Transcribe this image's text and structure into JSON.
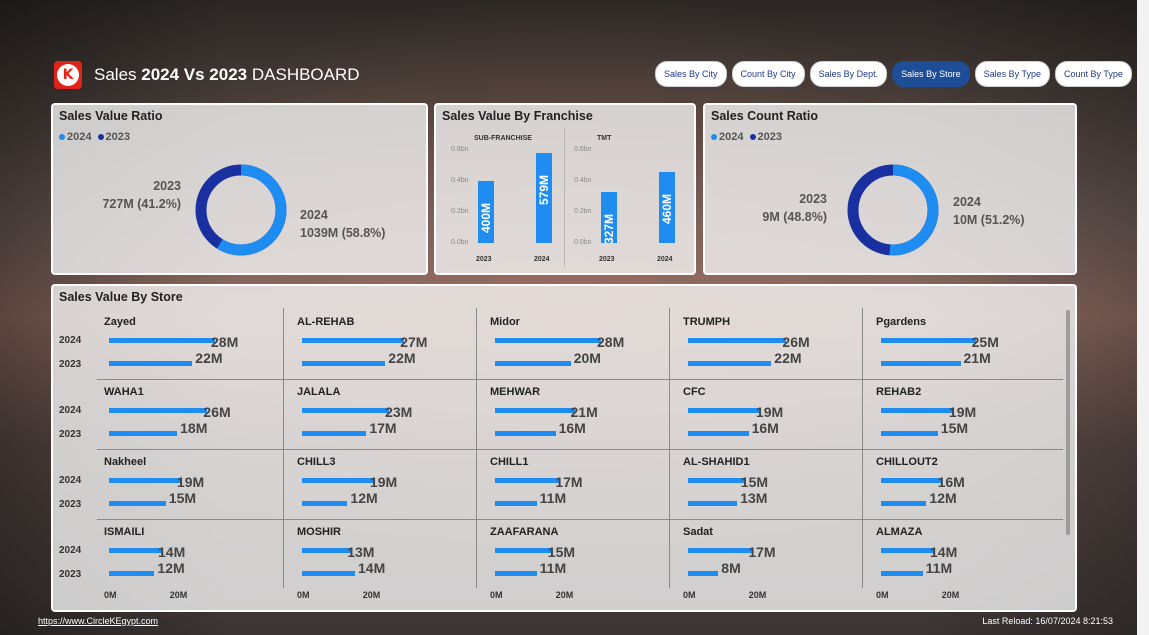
{
  "header": {
    "logo_letter": "K",
    "title_pre": "Sales ",
    "title_bold": "2024 Vs 2023",
    "title_post": " DASHBOARD"
  },
  "nav": [
    {
      "label": "Sales By City",
      "active": false
    },
    {
      "label": "Count By City",
      "active": false
    },
    {
      "label": "Sales By Dept.",
      "active": false
    },
    {
      "label": "Sales By Store",
      "active": true
    },
    {
      "label": "Sales By Type",
      "active": false
    },
    {
      "label": "Count By Type",
      "active": false
    }
  ],
  "colors": {
    "y2024": "#1e8cf0",
    "y2023": "#1a2fa0",
    "accent": "#1f4e99",
    "brand": "#e2231a"
  },
  "sales_ratio": {
    "title": "Sales Value Ratio",
    "legend_2024": "2024",
    "legend_2023": "2023",
    "y2023_label": "2023",
    "y2023_value": "727M (41.2%)",
    "y2024_label": "2024",
    "y2024_value": "1039M (58.8%)",
    "share_2024": 0.588
  },
  "franchise": {
    "title": "Sales Value By Franchise",
    "groups": [
      {
        "name": "SUB-FRANCHISE",
        "bars": [
          {
            "year": "2023",
            "value": 0.4,
            "label": "400M"
          },
          {
            "year": "2024",
            "value": 0.579,
            "label": "579M"
          }
        ]
      },
      {
        "name": "TMT",
        "bars": [
          {
            "year": "2023",
            "value": 0.327,
            "label": "327M"
          },
          {
            "year": "2024",
            "value": 0.46,
            "label": "460M"
          }
        ]
      }
    ],
    "ticks": [
      "0.6bn",
      "0.4bn",
      "0.2bn",
      "0.0bn"
    ]
  },
  "count_ratio": {
    "title": "Sales Count Ratio",
    "legend_2024": "2024",
    "legend_2023": "2023",
    "y2023_label": "2023",
    "y2023_value": "9M (48.8%)",
    "y2024_label": "2024",
    "y2024_value": "10M (51.2%)",
    "share_2024": 0.512
  },
  "stores": {
    "title": "Sales Value By Store",
    "row_labels": {
      "y2024": "2024",
      "y2023": "2023"
    },
    "axis_ticks": [
      "0M",
      "20M"
    ],
    "rows": [
      [
        {
          "name": "Zayed",
          "v2024": 28,
          "v2023": 22
        },
        {
          "name": "AL-REHAB",
          "v2024": 27,
          "v2023": 22
        },
        {
          "name": "Midor",
          "v2024": 28,
          "v2023": 20
        },
        {
          "name": "TRUMPH",
          "v2024": 26,
          "v2023": 22
        },
        {
          "name": "Pgardens",
          "v2024": 25,
          "v2023": 21
        }
      ],
      [
        {
          "name": "WAHA1",
          "v2024": 26,
          "v2023": 18
        },
        {
          "name": "JALALA",
          "v2024": 23,
          "v2023": 17
        },
        {
          "name": "MEHWAR",
          "v2024": 21,
          "v2023": 16
        },
        {
          "name": "CFC",
          "v2024": 19,
          "v2023": 16
        },
        {
          "name": "REHAB2",
          "v2024": 19,
          "v2023": 15
        }
      ],
      [
        {
          "name": "Nakheel",
          "v2024": 19,
          "v2023": 15
        },
        {
          "name": "CHILL3",
          "v2024": 19,
          "v2023": 12
        },
        {
          "name": "CHILL1",
          "v2024": 17,
          "v2023": 11
        },
        {
          "name": "AL-SHAHID1",
          "v2024": 15,
          "v2023": 13
        },
        {
          "name": "CHILLOUT2",
          "v2024": 16,
          "v2023": 12
        }
      ],
      [
        {
          "name": "ISMAILI",
          "v2024": 14,
          "v2023": 12
        },
        {
          "name": "MOSHIR",
          "v2024": 13,
          "v2023": 14
        },
        {
          "name": "ZAAFARANA",
          "v2024": 15,
          "v2023": 11
        },
        {
          "name": "Sadat",
          "v2024": 17,
          "v2023": 8
        },
        {
          "name": "ALMAZA",
          "v2024": 14,
          "v2023": 11
        }
      ]
    ]
  },
  "footer": {
    "link": "https://www.CircleKEgypt.com",
    "reload": "Last Reload: 16/07/2024 8:21:53"
  }
}
